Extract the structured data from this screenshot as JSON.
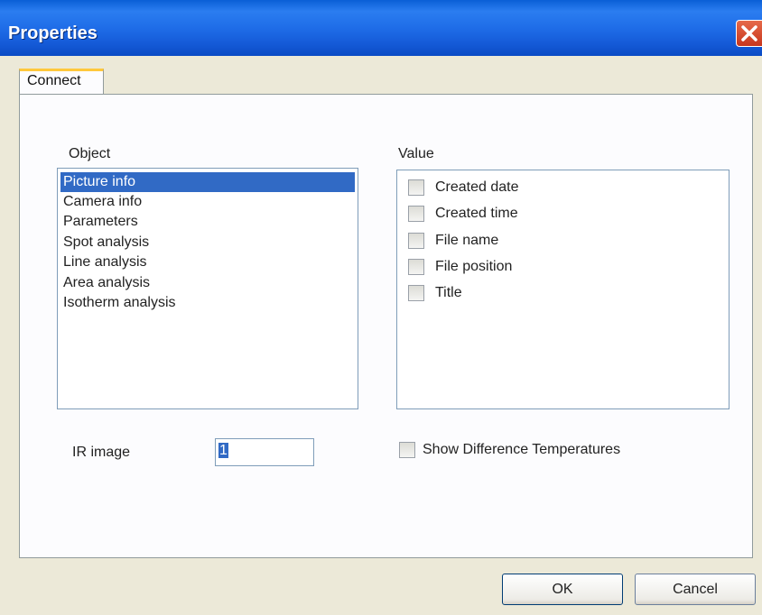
{
  "window": {
    "title": "Properties"
  },
  "tabs": [
    {
      "label": "Connect"
    }
  ],
  "object_list": {
    "header": "Object",
    "items": [
      {
        "label": "Picture info",
        "selected": true
      },
      {
        "label": "Camera info",
        "selected": false
      },
      {
        "label": "Parameters",
        "selected": false
      },
      {
        "label": "Spot analysis",
        "selected": false
      },
      {
        "label": "Line analysis",
        "selected": false
      },
      {
        "label": "Area analysis",
        "selected": false
      },
      {
        "label": "Isotherm analysis",
        "selected": false
      }
    ]
  },
  "value_list": {
    "header": "Value",
    "items": [
      {
        "label": "Created date",
        "checked": false
      },
      {
        "label": "Created time",
        "checked": false
      },
      {
        "label": "File name",
        "checked": false
      },
      {
        "label": "File position",
        "checked": false
      },
      {
        "label": "Title",
        "checked": false
      }
    ]
  },
  "ir_image": {
    "label": "IR image",
    "value": "1"
  },
  "show_difference": {
    "label": "Show Difference Temperatures",
    "checked": false
  },
  "buttons": {
    "ok": "OK",
    "cancel": "Cancel"
  },
  "colors": {
    "titlebar": "#1f6de8",
    "selection": "#316ac5",
    "tab_accent": "#ffc83c",
    "close": "#d2472c"
  }
}
